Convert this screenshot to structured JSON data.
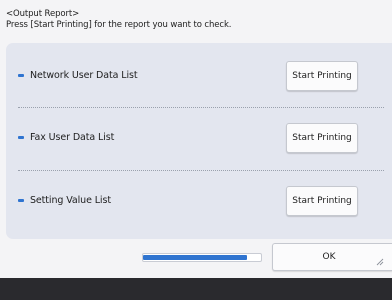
{
  "header": {
    "title": "<Output Report>",
    "instruction": "Press [Start Printing] for the report you want to check."
  },
  "reports": [
    {
      "label": "Network User Data List",
      "button": "Start Printing"
    },
    {
      "label": "Fax User Data List",
      "button": "Start Printing"
    },
    {
      "label": "Setting Value List",
      "button": "Start Printing"
    }
  ],
  "progress": {
    "value": 0.88
  },
  "footer": {
    "ok_label": "OK"
  },
  "colors": {
    "accent": "#2f74d0",
    "panel": "#e3e6ef",
    "background": "#f4f4f6",
    "bottom_bar": "#2a2a2e"
  },
  "icons": {
    "row_marker": "blue-dash-icon",
    "ok_corner": "resize-corner-icon"
  }
}
